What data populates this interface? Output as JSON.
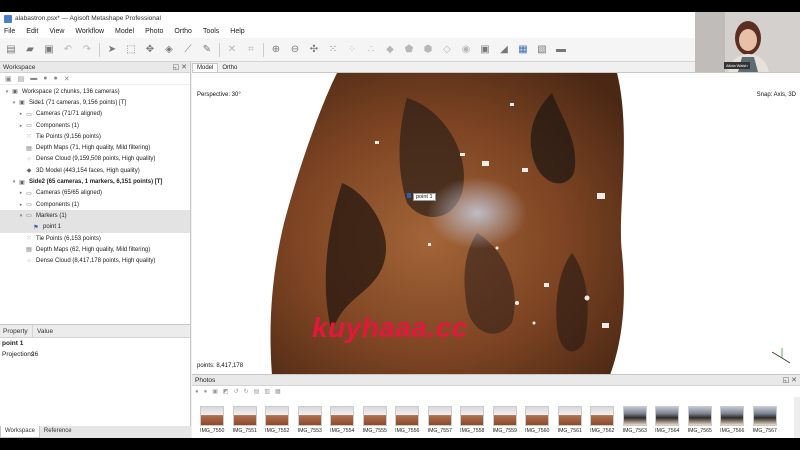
{
  "window": {
    "title": "alabastron.psx* — Agisoft Metashape Professional"
  },
  "menu": [
    "File",
    "Edit",
    "View",
    "Workflow",
    "Model",
    "Photo",
    "Ortho",
    "Tools",
    "Help"
  ],
  "workspace": {
    "title": "Workspace",
    "items": [
      {
        "label": "Workspace (2 chunks, 136 cameras)",
        "level": 0,
        "icon": "workspace-icon"
      },
      {
        "label": "Side1  (71 cameras, 9,156 points) [T]",
        "level": 1,
        "icon": "chunk-icon",
        "bold": false
      },
      {
        "label": "Cameras (71/71 aligned)",
        "level": 2,
        "icon": "folder-icon"
      },
      {
        "label": "Components (1)",
        "level": 2,
        "icon": "folder-icon"
      },
      {
        "label": "Tie Points (9,156 points)",
        "level": 2,
        "icon": "points-icon"
      },
      {
        "label": "Depth Maps (71, High quality, Mild filtering)",
        "level": 2,
        "icon": "depth-icon"
      },
      {
        "label": "Dense Cloud (9,159,508 points, High quality)",
        "level": 2,
        "icon": "cloud-icon"
      },
      {
        "label": "3D Model (443,154 faces, High quality)",
        "level": 2,
        "icon": "model-icon"
      },
      {
        "label": "Side2 (65 cameras, 1 markers, 6,151 points) [T]",
        "level": 1,
        "icon": "chunk-icon",
        "bold": true
      },
      {
        "label": "Cameras (65/65 aligned)",
        "level": 2,
        "icon": "folder-icon"
      },
      {
        "label": "Components (1)",
        "level": 2,
        "icon": "folder-icon"
      },
      {
        "label": "Markers (1)",
        "level": 2,
        "icon": "folder-icon",
        "selected": true
      },
      {
        "label": "point 1",
        "level": 3,
        "icon": "flag-icon",
        "selected": true
      },
      {
        "label": "Tie Points (6,153 points)",
        "level": 2,
        "icon": "points-icon"
      },
      {
        "label": "Depth Maps (62, High quality, Mild filtering)",
        "level": 2,
        "icon": "depth-icon"
      },
      {
        "label": "Dense Cloud (8,417,178 points, High quality)",
        "level": 2,
        "icon": "cloud-icon"
      }
    ]
  },
  "properties": {
    "col_property": "Property",
    "col_value": "Value",
    "title": "point 1",
    "rows": [
      {
        "key": "Projections",
        "value": "26"
      }
    ]
  },
  "bottom_tabs": [
    "Workspace",
    "Reference"
  ],
  "view": {
    "tabs": [
      "Model",
      "Ortho"
    ],
    "perspective": "Perspective: 30°",
    "snap": "Snap: Axis, 3D",
    "points": "points: 8,417,178",
    "marker_label": "point 1"
  },
  "photos": {
    "title": "Photos",
    "items": [
      "IMG_7550",
      "IMG_7551",
      "IMG_7552",
      "IMG_7553",
      "IMG_7554",
      "IMG_7555",
      "IMG_7556",
      "IMG_7557",
      "IMG_7558",
      "IMG_7559",
      "IMG_7560",
      "IMG_7561",
      "IMG_7562",
      "IMG_7563",
      "IMG_7564",
      "IMG_7565",
      "IMG_7566",
      "IMG_7567"
    ]
  },
  "webcam": {
    "name": "Alicia Walsh"
  },
  "watermark": "kuyhaaa.cc"
}
